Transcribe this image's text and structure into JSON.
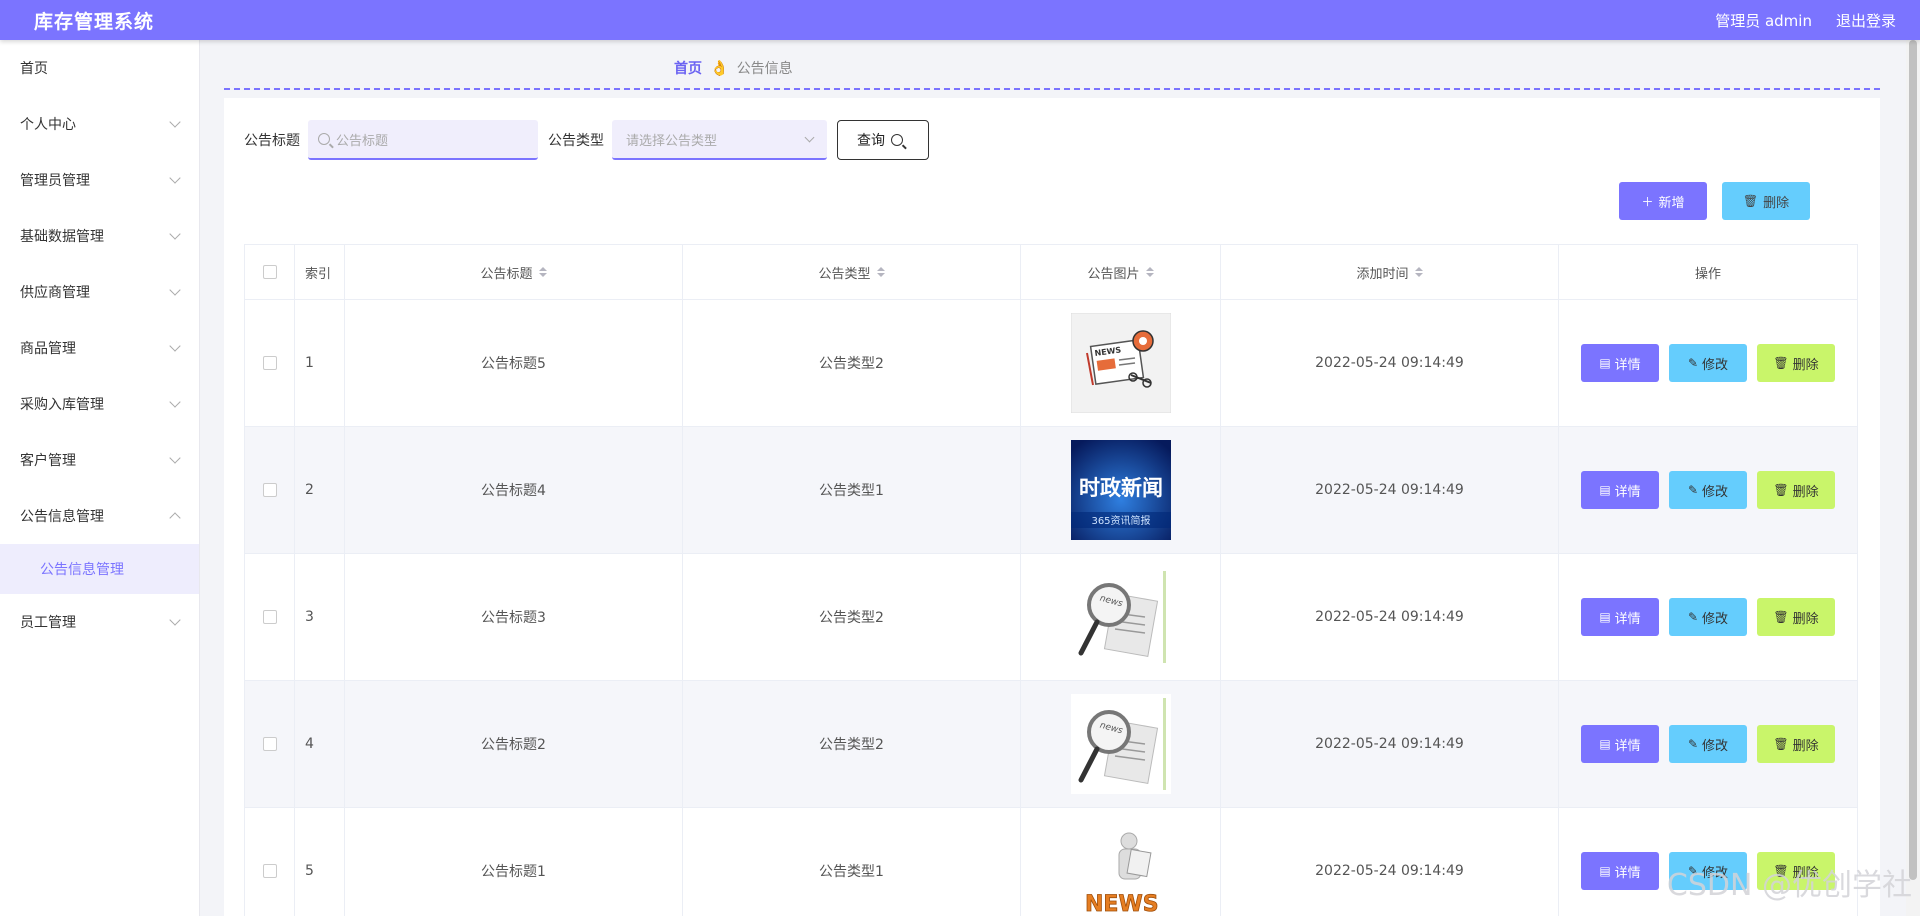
{
  "header": {
    "app_title": "库存管理系统",
    "user_label": "管理员 admin",
    "logout_label": "退出登录"
  },
  "sidebar": {
    "items": [
      {
        "label": "首页"
      },
      {
        "label": "个人中心"
      },
      {
        "label": "管理员管理"
      },
      {
        "label": "基础数据管理"
      },
      {
        "label": "供应商管理"
      },
      {
        "label": "商品管理"
      },
      {
        "label": "采购入库管理"
      },
      {
        "label": "客户管理"
      },
      {
        "label": "公告信息管理"
      },
      {
        "label": "员工管理"
      }
    ],
    "active_sub": "公告信息管理"
  },
  "breadcrumb": {
    "home": "首页",
    "separator": "👌",
    "current": "公告信息"
  },
  "search": {
    "title_label": "公告标题",
    "title_placeholder": "公告标题",
    "type_label": "公告类型",
    "type_placeholder": "请选择公告类型",
    "query_label": "查询"
  },
  "toolbar": {
    "add_label": "新增",
    "delete_label": "删除"
  },
  "table": {
    "headers": {
      "index": "索引",
      "title": "公告标题",
      "type": "公告类型",
      "image": "公告图片",
      "time": "添加时间",
      "ops": "操作"
    },
    "rows": [
      {
        "index": "1",
        "title": "公告标题5",
        "type": "公告类型2",
        "time": "2022-05-24 09:14:49",
        "image_icon": "news-illustration-icon"
      },
      {
        "index": "2",
        "title": "公告标题4",
        "type": "公告类型1",
        "time": "2022-05-24 09:14:49",
        "image_icon": "news-banner-image",
        "image_text": "时政新闻",
        "image_subtext": "365资讯简报"
      },
      {
        "index": "3",
        "title": "公告标题3",
        "type": "公告类型2",
        "time": "2022-05-24 09:14:49",
        "image_icon": "magnifier-newspaper-icon"
      },
      {
        "index": "4",
        "title": "公告标题2",
        "type": "公告类型2",
        "time": "2022-05-24 09:14:49",
        "image_icon": "magnifier-newspaper-icon"
      },
      {
        "index": "5",
        "title": "公告标题1",
        "type": "公告类型1",
        "time": "2022-05-24 09:14:49",
        "image_icon": "news-3d-figure-icon"
      }
    ],
    "op_labels": {
      "detail": "详情",
      "edit": "修改",
      "delete": "删除"
    }
  },
  "watermark": "CSDN @优创学社",
  "colors": {
    "primary": "#7b74ff",
    "info": "#65cdfd",
    "warning": "#c9f56a"
  }
}
